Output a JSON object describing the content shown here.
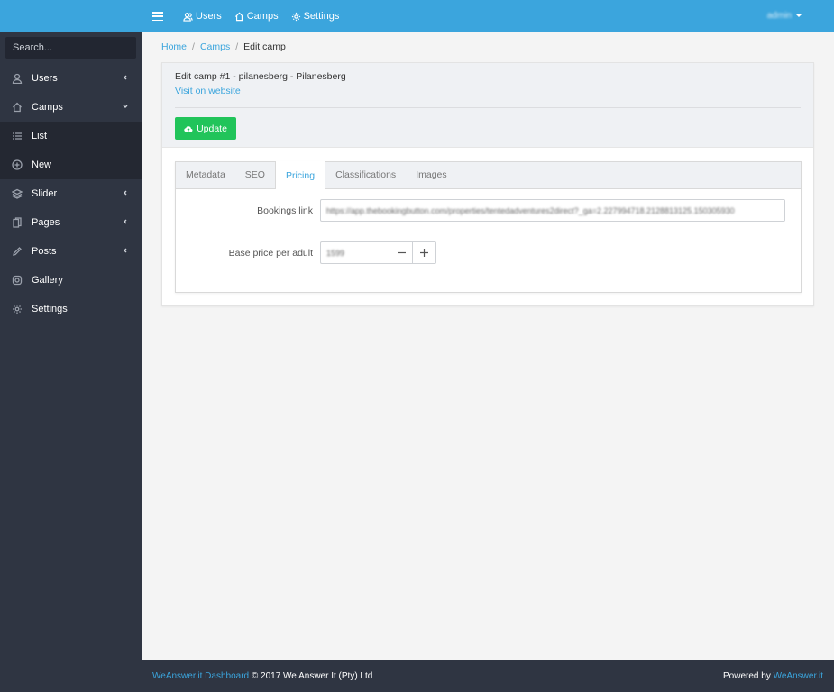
{
  "sidebar": {
    "search_placeholder": "Search...",
    "items": [
      {
        "label": "Users",
        "icon": "user-icon"
      },
      {
        "label": "Camps",
        "icon": "home-icon"
      },
      {
        "label": "List",
        "icon": "list-icon"
      },
      {
        "label": "New",
        "icon": "plus-circle-icon"
      },
      {
        "label": "Slider",
        "icon": "layers-icon"
      },
      {
        "label": "Pages",
        "icon": "pages-icon"
      },
      {
        "label": "Posts",
        "icon": "pencil-icon"
      },
      {
        "label": "Gallery",
        "icon": "instagram-icon"
      },
      {
        "label": "Settings",
        "icon": "gear-icon"
      }
    ]
  },
  "topbar": {
    "links": [
      {
        "label": "Users",
        "icon": "users-icon"
      },
      {
        "label": "Camps",
        "icon": "home-icon"
      },
      {
        "label": "Settings",
        "icon": "gear-icon"
      }
    ],
    "user": "admin"
  },
  "breadcrumb": {
    "home": "Home",
    "camps": "Camps",
    "current": "Edit camp",
    "separator": "/"
  },
  "card": {
    "title": "Edit camp #1 - pilanesberg - Pilanesberg",
    "link": "Visit on website",
    "update_label": "Update"
  },
  "tabs": [
    "Metadata",
    "SEO",
    "Pricing",
    "Classifications",
    "Images"
  ],
  "active_tab": "Pricing",
  "form": {
    "bookings_label": "Bookings link",
    "bookings_value": "https://app.thebookingbutton.com/properties/tentedadventures2direct?_ga=2.227994718.2128813125.150305930",
    "price_label": "Base price per adult",
    "price_value": "1599"
  },
  "footer": {
    "brand_link": "WeAnswer.it Dashboard",
    "copyright": "© 2017 We Answer It (Pty) Ltd",
    "powered_text": "Powered by",
    "powered_link": "WeAnswer.it"
  },
  "colors": {
    "accent": "#3ba5dd",
    "sidebar": "#2f3542",
    "success": "#21c45a"
  }
}
